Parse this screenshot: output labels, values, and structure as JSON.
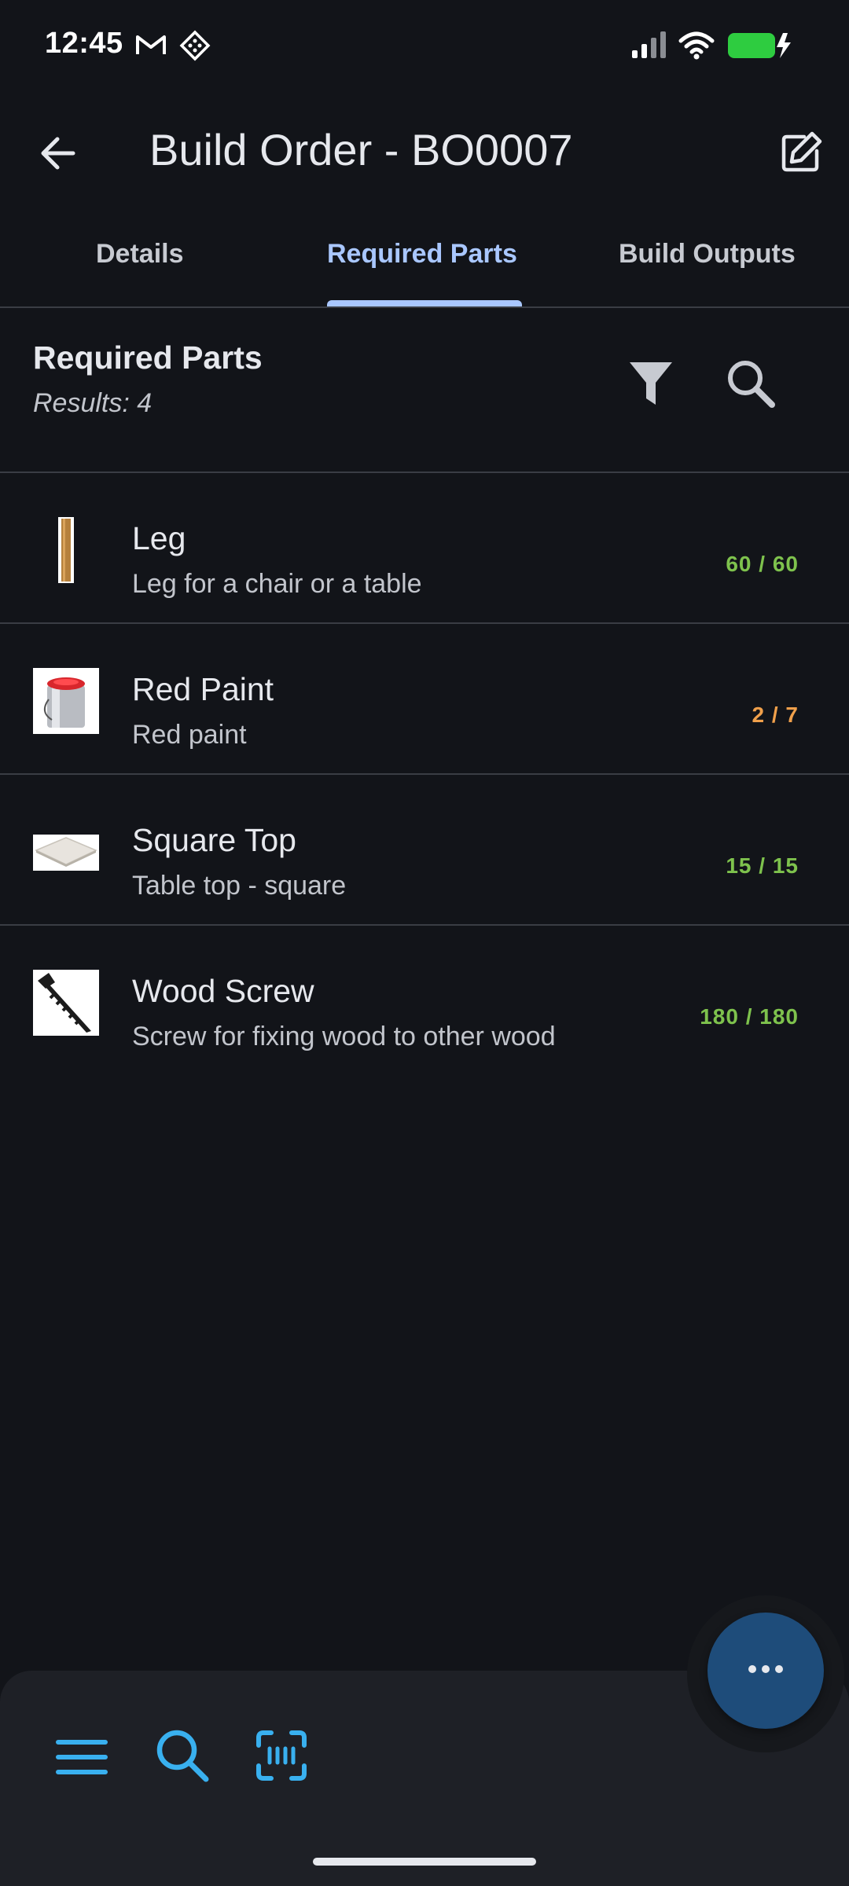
{
  "status_bar": {
    "time": "12:45",
    "icons": [
      "gmail-icon",
      "app-icon",
      "signal-icon",
      "wifi-icon",
      "battery-charging-icon"
    ]
  },
  "app_bar": {
    "title": "Build Order - BO0007",
    "back_icon": "arrow-left-icon",
    "edit_icon": "edit-icon"
  },
  "tabs": [
    {
      "label": "Details",
      "active": false
    },
    {
      "label": "Required Parts",
      "active": true
    },
    {
      "label": "Build Outputs",
      "active": false
    }
  ],
  "section": {
    "title": "Required Parts",
    "results": "Results: 4",
    "filter_icon": "filter-icon",
    "search_icon": "search-icon"
  },
  "parts": [
    {
      "name": "Leg",
      "description": "Leg for a chair or a table",
      "quantity": "60 / 60",
      "status_color": "#7ec24d",
      "thumbnail": "leg-thumbnail"
    },
    {
      "name": "Red Paint",
      "description": "Red paint",
      "quantity": "2 / 7",
      "status_color": "#f0a04b",
      "thumbnail": "paint-can-thumbnail"
    },
    {
      "name": "Square Top",
      "description": "Table top - square",
      "quantity": "15 / 15",
      "status_color": "#7ec24d",
      "thumbnail": "table-top-thumbnail"
    },
    {
      "name": "Wood Screw",
      "description": "Screw for fixing wood to other wood",
      "quantity": "180 / 180",
      "status_color": "#7ec24d",
      "thumbnail": "screw-thumbnail"
    }
  ],
  "fab": {
    "icon": "more-horizontal-icon"
  },
  "bottom_bar": {
    "icons": [
      "menu-icon",
      "search-icon",
      "scan-icon"
    ],
    "accent": "#39b0ef"
  }
}
